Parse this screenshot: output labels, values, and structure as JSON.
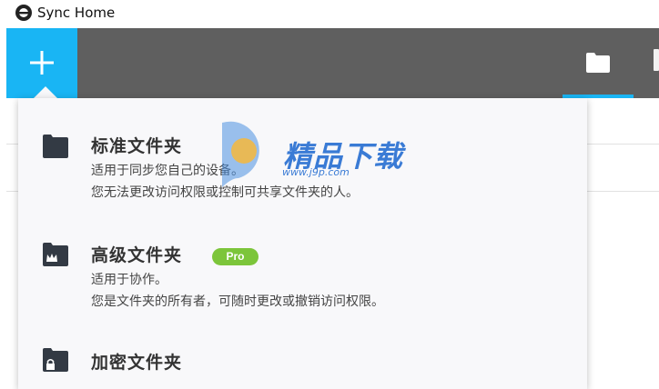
{
  "window": {
    "title": "Sync Home",
    "icon": "sync-logo-icon"
  },
  "toolbar": {
    "add_icon": "plus-icon",
    "folder_icon": "folder-icon",
    "accent": "#19b5f4",
    "background": "#5f5f5f"
  },
  "menu": {
    "items": [
      {
        "icon": "folder-icon",
        "title": "标准文件夹",
        "desc1": "适用于同步您自己的设备。",
        "desc2": "您无法更改访问权限或控制可共享文件夹的人。"
      },
      {
        "icon": "folder-crown-icon",
        "title": "高级文件夹",
        "badge": "Pro",
        "desc1": "适用于协作。",
        "desc2": "您是文件夹的所有者，可随时更改或撤销访问权限。"
      },
      {
        "icon": "folder-lock-icon",
        "title": "加密文件夹"
      }
    ],
    "badge_color": "#7cc53a"
  },
  "watermark": {
    "text": "精品下载",
    "url": "www.j9p.com"
  }
}
